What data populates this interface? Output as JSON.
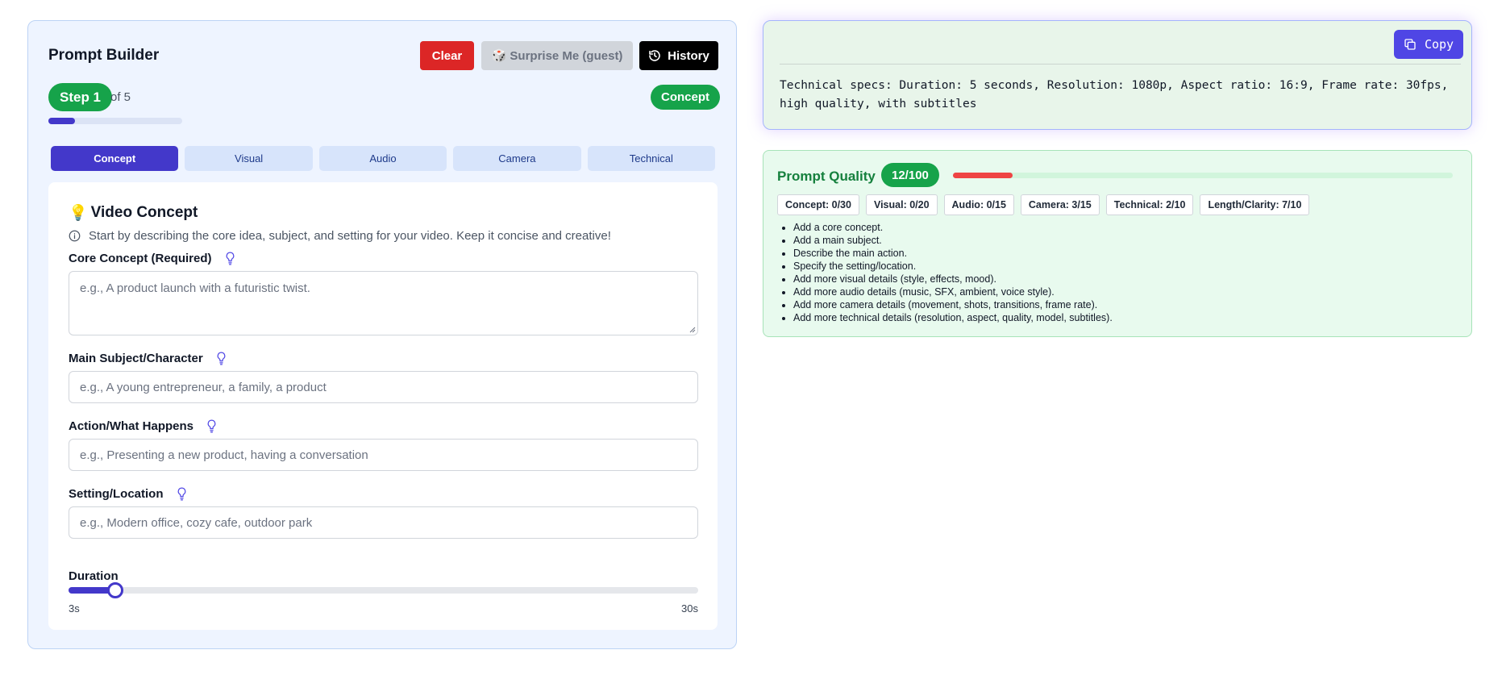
{
  "builder": {
    "title": "Prompt Builder",
    "buttons": {
      "clear": "Clear",
      "surprise": "🎲 Surprise Me (guest)",
      "history": "History"
    },
    "step": {
      "label": "Step 1",
      "of": "of 5",
      "progress_fraction": 0.2
    },
    "current_badge": "Concept",
    "tabs": [
      {
        "label": "Concept",
        "active": true
      },
      {
        "label": "Visual",
        "active": false
      },
      {
        "label": "Audio",
        "active": false
      },
      {
        "label": "Camera",
        "active": false
      },
      {
        "label": "Technical",
        "active": false
      }
    ]
  },
  "concept": {
    "icon": "💡",
    "title": "Video Concept",
    "hint": "Start by describing the core idea, subject, and setting for your video. Keep it concise and creative!",
    "fields": [
      {
        "label": "Core Concept (Required)",
        "placeholder": "e.g., A product launch with a futuristic twist."
      },
      {
        "label": "Main Subject/Character",
        "placeholder": "e.g., A young entrepreneur, a family, a product"
      },
      {
        "label": "Action/What Happens",
        "placeholder": "e.g., Presenting a new product, having a conversation"
      },
      {
        "label": "Setting/Location",
        "placeholder": "e.g., Modern office, cozy cafe, outdoor park"
      }
    ],
    "duration": {
      "label": "Duration",
      "min_label": "3s",
      "max_label": "30s",
      "min": 3,
      "max": 30,
      "value": 5
    }
  },
  "output": {
    "copy_label": "Copy",
    "text": "Technical specs: Duration: 5 seconds, Resolution: 1080p, Aspect ratio: 16:9, Frame rate: 30fps, high quality, with subtitles"
  },
  "quality": {
    "title": "Prompt Quality",
    "score_label": "12/100",
    "score": 12,
    "score_max": 100,
    "chips": [
      "Concept: 0/30",
      "Visual: 0/20",
      "Audio: 0/15",
      "Camera: 3/15",
      "Technical: 2/10",
      "Length/Clarity: 7/10"
    ],
    "tips": [
      "Add a core concept.",
      "Add a main subject.",
      "Describe the main action.",
      "Specify the setting/location.",
      "Add more visual details (style, effects, mood).",
      "Add more audio details (music, SFX, ambient, voice style).",
      "Add more camera details (movement, shots, transitions, frame rate).",
      "Add more technical details (resolution, aspect, quality, model, subtitles)."
    ]
  },
  "colors": {
    "primary": "#4338ca",
    "success": "#16a34a",
    "danger": "#dc2626",
    "quality_bar": "#ef4444"
  },
  "icons": {
    "history": "history-clock-icon",
    "copy": "copy-icon",
    "info": "info-icon",
    "hint": "lightbulb-icon"
  }
}
